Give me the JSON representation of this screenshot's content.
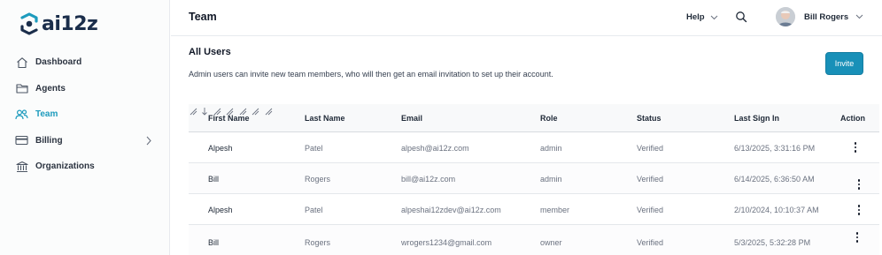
{
  "brand": {
    "name": "ai12z",
    "accent": "#1890b8"
  },
  "sidebar": {
    "items": [
      {
        "label": "Dashboard",
        "icon": "home-icon"
      },
      {
        "label": "Agents",
        "icon": "folder-icon"
      },
      {
        "label": "Team",
        "icon": "users-icon",
        "active": true
      },
      {
        "label": "Billing",
        "icon": "credit-card-icon",
        "expandable": true
      },
      {
        "label": "Organizations",
        "icon": "bank-icon"
      }
    ]
  },
  "header": {
    "title": "Team",
    "help_label": "Help",
    "user_name": "Bill Rogers"
  },
  "main": {
    "section_title": "All Users",
    "description": "Admin users can invite new team members, who will then get an email invitation to set up their account.",
    "invite_label": "Invite",
    "table": {
      "columns": [
        "First Name",
        "Last Name",
        "Email",
        "Role",
        "Status",
        "Last Sign In",
        "Action"
      ],
      "rows": [
        {
          "first": "Alpesh",
          "last": "Patel",
          "email": "alpesh@ai12z.com",
          "role": "admin",
          "status": "Verified",
          "last_sign_in": "6/13/2025, 3:31:16 PM"
        },
        {
          "first": "Bill",
          "last": "Rogers",
          "email": "bill@ai12z.com",
          "role": "admin",
          "status": "Verified",
          "last_sign_in": "6/14/2025, 6:36:50 AM"
        },
        {
          "first": "Alpesh",
          "last": "Patel",
          "email": "alpeshai12zdev@ai12z.com",
          "role": "member",
          "status": "Verified",
          "last_sign_in": "2/10/2024, 10:10:37 AM"
        },
        {
          "first": "Bill",
          "last": "Rogers",
          "email": "wrogers1234@gmail.com",
          "role": "owner",
          "status": "Verified",
          "last_sign_in": "5/3/2025, 5:32:28 PM"
        }
      ]
    }
  }
}
